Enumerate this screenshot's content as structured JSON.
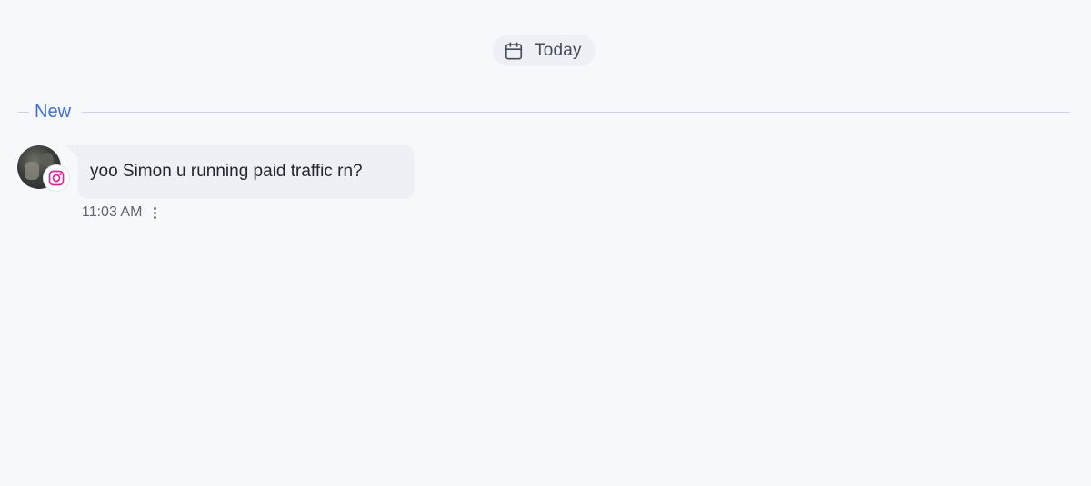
{
  "date_chip": {
    "label": "Today",
    "icon": "calendar-icon"
  },
  "divider": {
    "label": "New",
    "color": "#3f6fd8"
  },
  "message": {
    "sender_avatar": "avatar",
    "channel_icon": "instagram-icon",
    "channel_color": "#d6249f",
    "text": "yoo Simon u running paid traffic rn?",
    "time": "11:03 AM",
    "more_icon": "more-vertical-icon"
  }
}
